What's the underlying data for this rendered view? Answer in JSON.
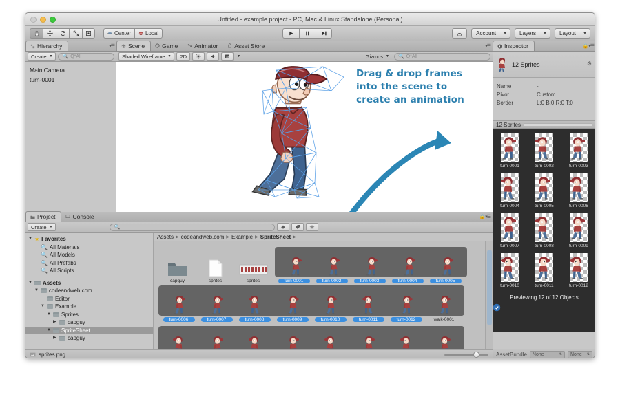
{
  "window": {
    "title": "Untitled - example project - PC, Mac & Linux Standalone (Personal)"
  },
  "toolbar": {
    "tools": [
      {
        "name": "hand-tool",
        "glyph": "✋"
      },
      {
        "name": "move-tool",
        "glyph": "✛"
      },
      {
        "name": "rotate-tool",
        "glyph": "⟳"
      },
      {
        "name": "scale-tool",
        "glyph": "⤢"
      },
      {
        "name": "rect-tool",
        "glyph": "▣"
      }
    ],
    "pivot_mode": "Center",
    "pivot_rotation": "Local",
    "play": "▶",
    "pause": "❚❚",
    "step": "▶|",
    "cloud_label": "☁",
    "account": "Account",
    "layers": "Layers",
    "layout": "Layout"
  },
  "hierarchy": {
    "tab": "Hierarchy",
    "create": "Create",
    "search_placeholder": "Q*All",
    "items": [
      "Main Camera",
      "turn-0001"
    ]
  },
  "scene": {
    "tabs": [
      "Scene",
      "Game",
      "Animator",
      "Asset Store"
    ],
    "active_tab": "Scene",
    "shading": "Shaded Wireframe",
    "mode_2d": "2D",
    "gizmos": "Gizmos",
    "search_placeholder": "Q*All",
    "annotation": "Drag & drop frames into the scene to create an animation",
    "accent": "#2b7fae"
  },
  "inspector": {
    "tab": "Inspector",
    "title": "12 Sprites",
    "properties": [
      {
        "key": "Name",
        "value": "-"
      },
      {
        "key": "Pivot",
        "value": "Custom"
      },
      {
        "key": "Border",
        "value": "L:0 B:0 R:0 T:0"
      }
    ],
    "preview_header": "12 Sprites",
    "sprites": [
      "turn-0001",
      "turn-0002",
      "turn-0003",
      "turn-0004",
      "turn-0005",
      "turn-0006",
      "turn-0007",
      "turn-0008",
      "turn-0009",
      "turn-0010",
      "turn-0011",
      "turn-0012"
    ],
    "preview_status": "Previewing 12 of 12 Objects",
    "assetbundle_label": "AssetBundle",
    "assetbundle_value": "None",
    "assetbundle_variant": "None"
  },
  "project": {
    "tabs": [
      "Project",
      "Console"
    ],
    "active_tab": "Project",
    "create": "Create",
    "search_placeholder": "",
    "breadcrumb": [
      "Assets",
      "codeandweb.com",
      "Example",
      "SpriteSheet"
    ],
    "tree": [
      {
        "label": "Favorites",
        "depth": 0,
        "tri": "▼",
        "icon": "star",
        "bold": true
      },
      {
        "label": "All Materials",
        "depth": 1,
        "tri": "",
        "icon": "search"
      },
      {
        "label": "All Models",
        "depth": 1,
        "tri": "",
        "icon": "search"
      },
      {
        "label": "All Prefabs",
        "depth": 1,
        "tri": "",
        "icon": "search"
      },
      {
        "label": "All Scripts",
        "depth": 1,
        "tri": "",
        "icon": "search"
      },
      {
        "label": "",
        "depth": 0,
        "tri": "",
        "icon": "none"
      },
      {
        "label": "Assets",
        "depth": 0,
        "tri": "▼",
        "icon": "folder",
        "bold": true
      },
      {
        "label": "codeandweb.com",
        "depth": 1,
        "tri": "▼",
        "icon": "folder"
      },
      {
        "label": "Editor",
        "depth": 2,
        "tri": "",
        "icon": "folder"
      },
      {
        "label": "Example",
        "depth": 2,
        "tri": "▼",
        "icon": "folder"
      },
      {
        "label": "Sprites",
        "depth": 3,
        "tri": "▼",
        "icon": "folder"
      },
      {
        "label": "capguy",
        "depth": 4,
        "tri": "▶",
        "icon": "folder"
      },
      {
        "label": "SpriteSheet",
        "depth": 3,
        "tri": "▼",
        "icon": "folder",
        "selected": true
      },
      {
        "label": "capguy",
        "depth": 4,
        "tri": "▶",
        "icon": "folder"
      }
    ],
    "row1_assets": [
      {
        "label": "capguy",
        "kind": "folder"
      },
      {
        "label": "sprites",
        "kind": "file"
      },
      {
        "label": "sprites",
        "kind": "spritesheet"
      }
    ],
    "strip1": [
      "turn-0001",
      "turn-0002",
      "turn-0003",
      "turn-0004",
      "turn-0005"
    ],
    "strip2": [
      "turn-0006",
      "turn-0007",
      "turn-0008",
      "turn-0009",
      "turn-0010",
      "turn-0011",
      "turn-0012",
      "walk-0001"
    ],
    "strip2_unselected": "walk-0001",
    "strip3_count": 8,
    "status": "sprites.png",
    "selection_color": "#3b8fe0"
  }
}
